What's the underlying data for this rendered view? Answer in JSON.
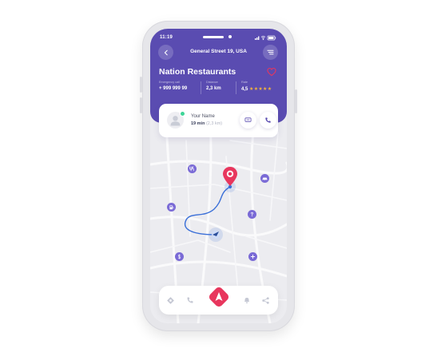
{
  "header": {
    "time": "11:19",
    "address": "General Street 19, USA",
    "restaurant_title": "Nation Restaurants",
    "info": [
      {
        "label": "Emergency call",
        "value": "+ 999 999 99"
      },
      {
        "label": "Distance",
        "value": "2,3 km"
      },
      {
        "label": "Rate",
        "value": "4,5",
        "stars": "★★★★★"
      }
    ]
  },
  "driver": {
    "name": "Your Name",
    "eta": "19 min",
    "distance": "(2,3 km)"
  },
  "colors": {
    "header_purple": "#5a4cb1",
    "route_blue": "#3a6fd8",
    "pin_red": "#e8365d",
    "poi_purple": "#7a6ad6",
    "star_gold": "#f5b43a"
  },
  "icons": {
    "poi": [
      "restaurant-icon",
      "car-icon",
      "fuel-icon",
      "question-icon",
      "dollar-icon",
      "plus-icon"
    ],
    "nav": [
      "ticket-icon",
      "phone-icon",
      "navigation-icon",
      "bell-icon",
      "share-icon"
    ]
  }
}
